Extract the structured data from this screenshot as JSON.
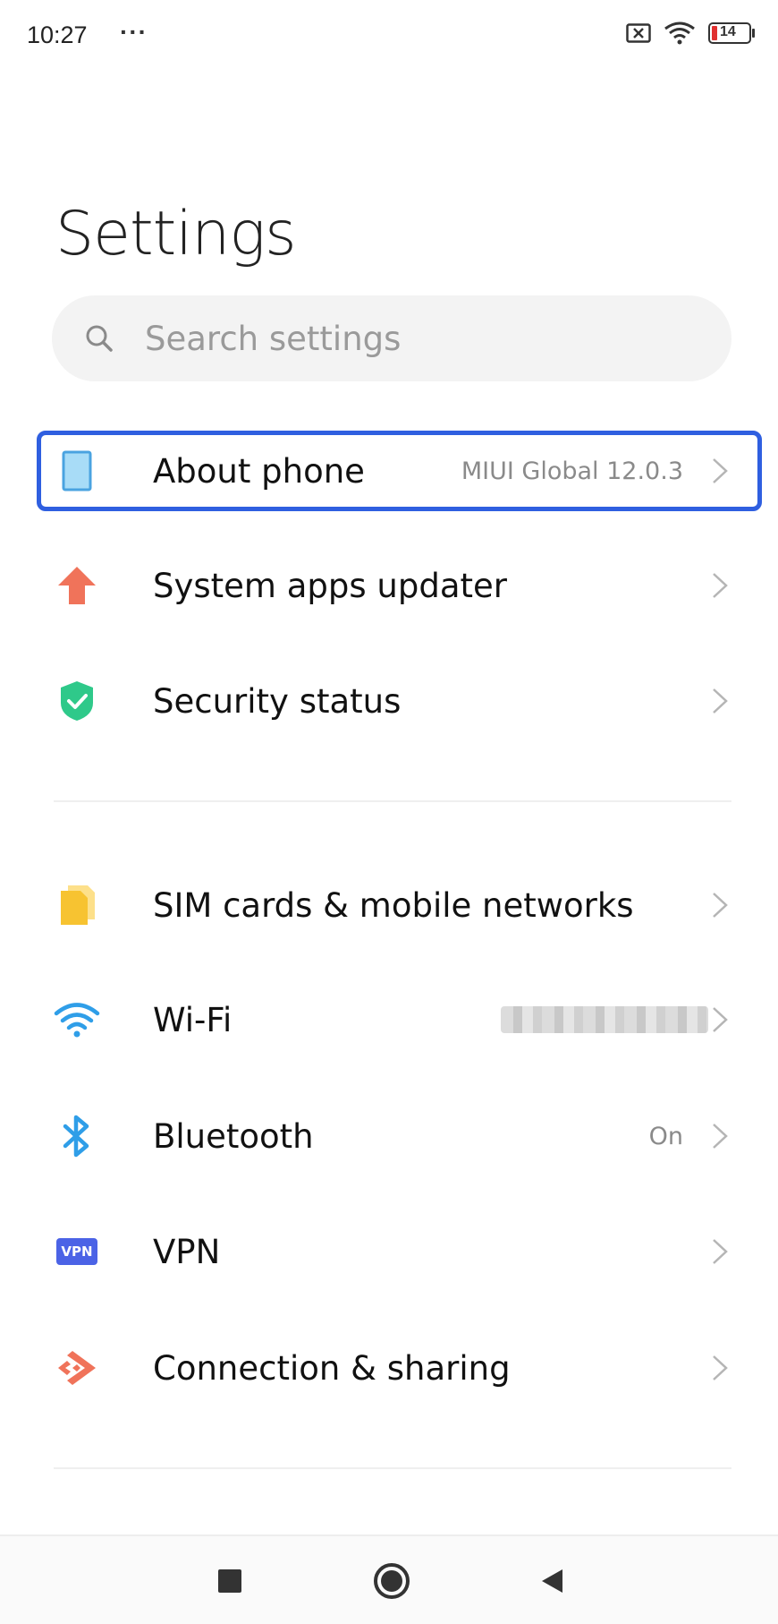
{
  "status_bar": {
    "time": "10:27",
    "more_dots": "···",
    "battery_level": "14",
    "icons": [
      "no-sim-icon",
      "wifi-icon",
      "battery-icon"
    ]
  },
  "header": {
    "title": "Settings"
  },
  "search": {
    "placeholder": "Search settings",
    "icon": "search-icon"
  },
  "settings_items": [
    {
      "id": "about-phone",
      "label": "About phone",
      "value": "MIUI Global 12.0.3",
      "icon": "phone-icon",
      "icon_color": "#4aa3e0",
      "highlighted": true
    },
    {
      "id": "system-apps-updater",
      "label": "System apps updater",
      "value": "",
      "icon": "up-arrow-icon",
      "icon_color": "#f0735a"
    },
    {
      "id": "security-status",
      "label": "Security status",
      "value": "",
      "icon": "shield-check-icon",
      "icon_color": "#2fc98a"
    },
    {
      "id": "sim-cards",
      "label": "SIM cards & mobile networks",
      "value": "",
      "icon": "sim-card-icon",
      "icon_color": "#f7c331"
    },
    {
      "id": "wifi",
      "label": "Wi-Fi",
      "value": "",
      "value_blurred": true,
      "icon": "wifi-icon",
      "icon_color": "#2f9ee8"
    },
    {
      "id": "bluetooth",
      "label": "Bluetooth",
      "value": "On",
      "icon": "bluetooth-icon",
      "icon_color": "#2f9ee8"
    },
    {
      "id": "vpn",
      "label": "VPN",
      "value": "",
      "icon": "vpn-icon",
      "icon_color": "#4b63e6",
      "icon_text": "VPN"
    },
    {
      "id": "connection-sharing",
      "label": "Connection & sharing",
      "value": "",
      "icon": "connection-sharing-icon",
      "icon_color": "#f0735a"
    }
  ],
  "nav_bar": {
    "buttons": [
      "recents-square-icon",
      "home-circle-icon",
      "back-triangle-icon"
    ]
  },
  "colors": {
    "highlight_border": "#2f5fe0",
    "search_bg": "#f3f3f3",
    "secondary_text": "#8a8a8a"
  }
}
